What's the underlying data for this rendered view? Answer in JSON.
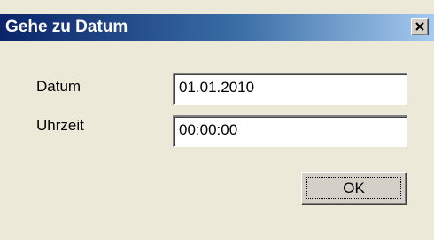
{
  "dialog": {
    "title": "Gehe zu Datum",
    "close_icon": "close-icon"
  },
  "form": {
    "date_label": "Datum",
    "date_value": "01.01.2010",
    "time_label": "Uhrzeit",
    "time_value": "00:00:00"
  },
  "buttons": {
    "ok_label": "OK"
  },
  "colors": {
    "title_gradient_start": "#0a246a",
    "title_gradient_end": "#a6caf0",
    "face": "#ece9d8",
    "button_face": "#d4d0c8"
  }
}
